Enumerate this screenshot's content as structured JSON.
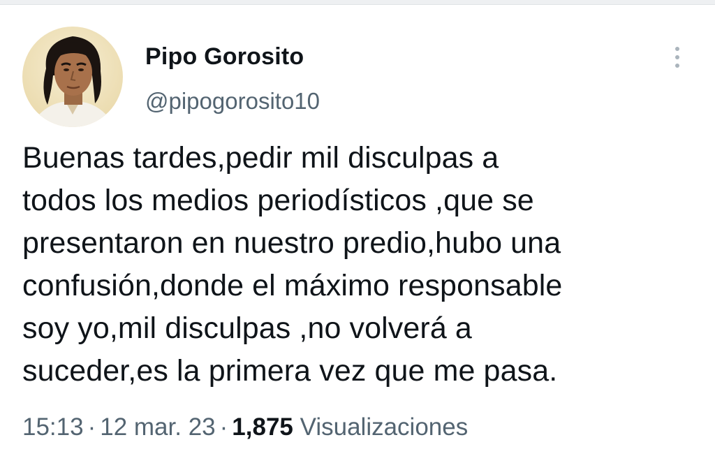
{
  "user": {
    "display_name": "Pipo Gorosito",
    "handle": "@pipogorosito10"
  },
  "tweet": {
    "lines": [
      "Buenas tardes,pedir mil disculpas a",
      "todos los medios periodísticos ,que se",
      "presentaron en nuestro predio,hubo una",
      "confusión,donde el máximo responsable",
      "soy yo,mil disculpas ,no volverá a",
      "suceder,es la primera vez que me pasa."
    ]
  },
  "meta": {
    "time": "15:13",
    "separator": "·",
    "date": "12 mar. 23",
    "views_count": "1,875",
    "views_label": "Visualizaciones"
  },
  "icons": {
    "more": "more-vertical-icon",
    "avatar": "profile-photo"
  },
  "colors": {
    "text_primary": "#0f1419",
    "text_secondary": "#536471",
    "more_dots": "#aab4bc"
  }
}
